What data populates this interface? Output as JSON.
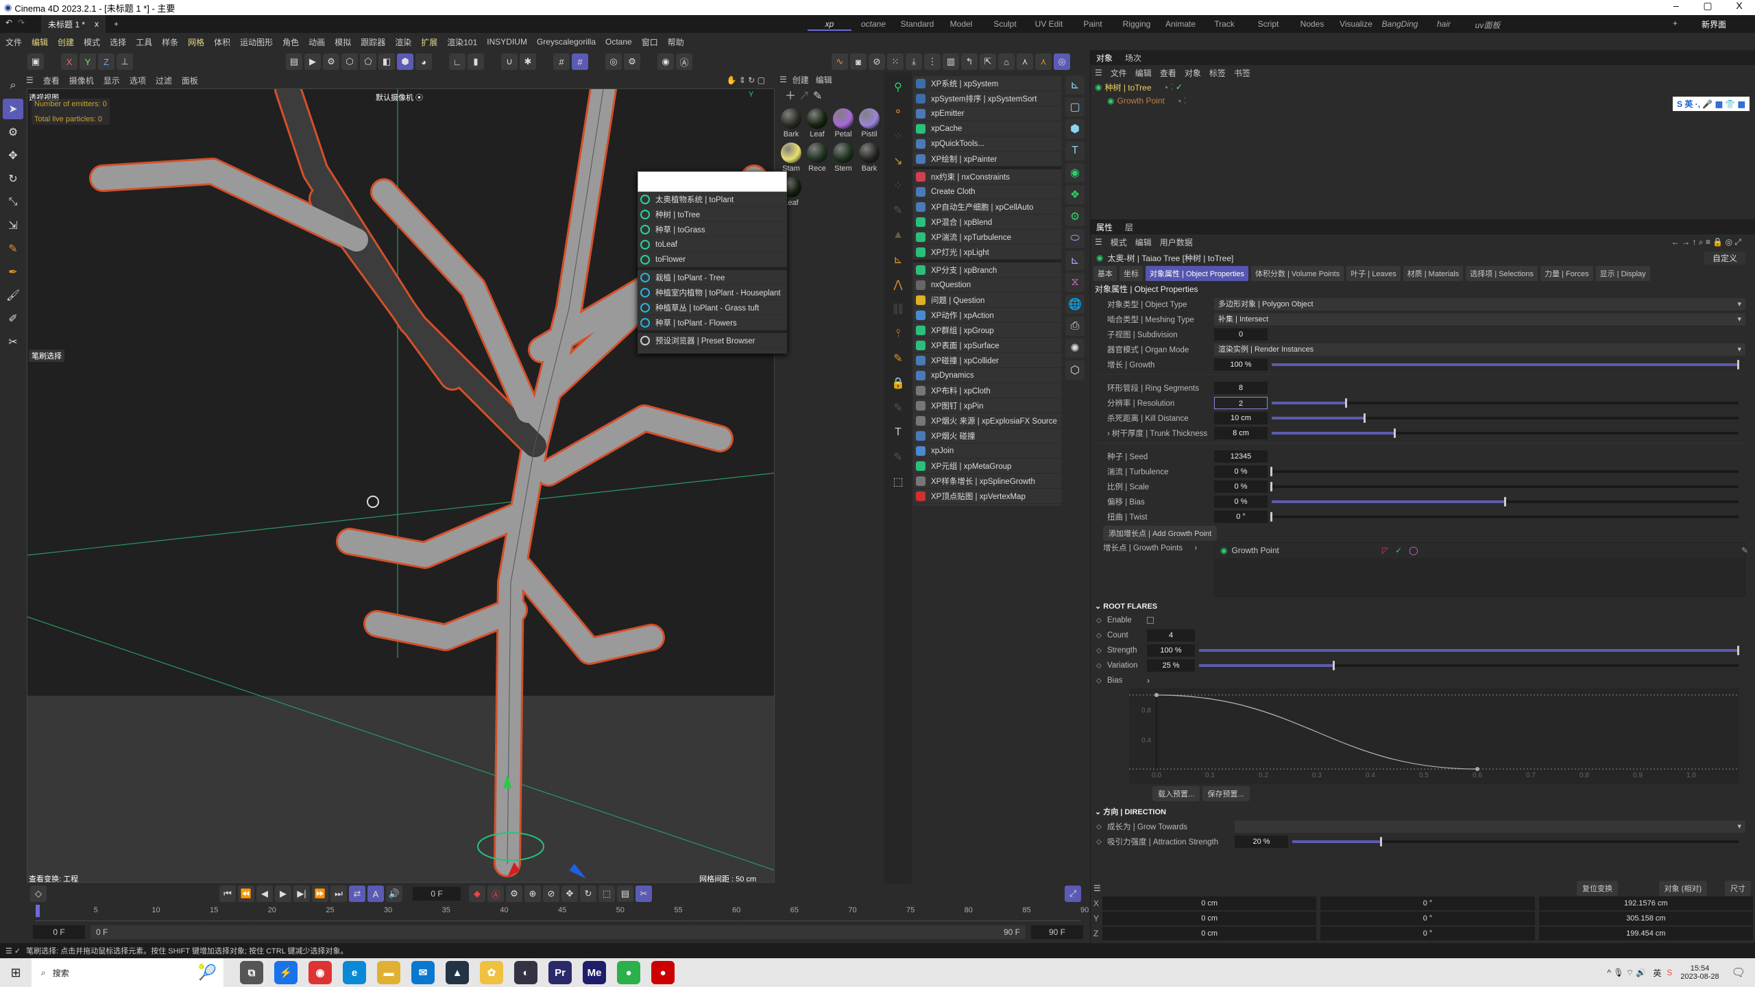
{
  "window": {
    "title": "Cinema 4D 2023.2.1 - [未标题 1 *] - 主要",
    "minimize": "–",
    "maximize": "▢",
    "close": "X"
  },
  "tabs": {
    "doc": "未标题 1 *",
    "close": "x",
    "add": "+"
  },
  "layouts": [
    "xp",
    "octane",
    "Standard",
    "Model",
    "Sculpt",
    "UV Edit",
    "Paint",
    "Rigging",
    "Animate",
    "Track",
    "Script",
    "Nodes",
    "Visualize",
    "BangDing",
    "hair",
    "uv面板"
  ],
  "layout_active": "xp",
  "layout_add": "+",
  "new_ui": "新界面",
  "menu": [
    "文件",
    "编辑",
    "创建",
    "模式",
    "选择",
    "工具",
    "样条",
    "网格",
    "体积",
    "运动图形",
    "角色",
    "动画",
    "模拟",
    "跟踪器",
    "渲染",
    "扩展",
    "渲染101",
    "INSYDIUM",
    "Greyscalegorilla",
    "Octane",
    "窗口",
    "帮助"
  ],
  "toolbar": {
    "x": "X",
    "y": "Y",
    "z": "Z"
  },
  "viewport": {
    "menu": [
      "查看",
      "摄像机",
      "显示",
      "选项",
      "过滤",
      "面板"
    ],
    "name": "透视视图",
    "camera": "默认摄像机 ⦿",
    "emitters": "Number of emitters: 0",
    "particles": "Total live particles: 0",
    "transform": "查看变换: 工程",
    "grid": "网格间距 : 50 cm",
    "brush": "笔刷选择",
    "axis_y": "Y",
    "axis_x": "X",
    "axis_z": "Z"
  },
  "materials": {
    "menu": [
      "创建",
      "编辑"
    ],
    "items": [
      {
        "name": "Bark",
        "color": "#2a2a22"
      },
      {
        "name": "Leaf",
        "color": "#13240f"
      },
      {
        "name": "Petal",
        "color": "#a86ad6"
      },
      {
        "name": "Pistil",
        "color": "#9c85d8"
      },
      {
        "name": "Stam",
        "color": "#e8e070"
      },
      {
        "name": "Rece",
        "color": "#1f3320"
      },
      {
        "name": "Stem",
        "color": "#1d321c"
      },
      {
        "name": "Bark",
        "color": "#262620"
      },
      {
        "name": "Leaf",
        "color": "#14200f"
      }
    ]
  },
  "xp_menu": [
    {
      "label": "XP系统 | xpSystem",
      "color": "#3a6ea8"
    },
    {
      "label": "xpSystem排序 | xpSystemSort",
      "color": "#3a6ea8"
    },
    {
      "label": "xpEmitter",
      "color": "#4a7ab8"
    },
    {
      "label": "xpCache",
      "color": "#2bbf7a"
    },
    {
      "label": "xpQuickTools...",
      "color": "#4a7ab8"
    },
    {
      "label": "XP绘制 | xpPainter",
      "color": "#4a7ab8"
    },
    {
      "sep": true
    },
    {
      "label": "nx约束 | nxConstraints",
      "color": "#d04050"
    },
    {
      "label": "Create Cloth",
      "color": "#4a7ab8"
    },
    {
      "label": "XP自动生产细胞 | xpCellAuto",
      "color": "#4a7ab8"
    },
    {
      "label": "XP混合 | xpBlend",
      "color": "#2bbf7a"
    },
    {
      "label": "XP湍流 | xpTurbulence",
      "color": "#2bbf7a"
    },
    {
      "label": "XP灯光 | xpLight",
      "color": "#2bbf7a"
    },
    {
      "sep": true
    },
    {
      "label": "XP分支 | xpBranch",
      "color": "#2bbf7a"
    },
    {
      "label": "nxQuestion",
      "color": "#666"
    },
    {
      "label": "问题 | Question",
      "color": "#e0b020"
    },
    {
      "label": "XP动作 | xpAction",
      "color": "#4a8ad0"
    },
    {
      "label": "XP群组 | xpGroup",
      "color": "#2bbf7a"
    },
    {
      "label": "XP表面 | xpSurface",
      "color": "#2bbf7a"
    },
    {
      "label": "XP碰撞 | xpCollider",
      "color": "#4a7ab8"
    },
    {
      "label": "xpDynamics",
      "color": "#4a7ab8"
    },
    {
      "label": "XP布料 | xpCloth",
      "color": "#777"
    },
    {
      "label": "XP图钉 | xpPin",
      "color": "#777"
    },
    {
      "label": "XP烟火 来源 | xpExplosiaFX Source",
      "color": "#777"
    },
    {
      "label": "XP烟火 碰撞",
      "color": "#4a7ab8"
    },
    {
      "label": "xpJoin",
      "color": "#4a8ad0"
    },
    {
      "label": "XP元组 | xpMetaGroup",
      "color": "#2bbf7a"
    },
    {
      "label": "XP样条增长 | xpSplineGrowth",
      "color": "#777"
    },
    {
      "label": "XP顶点贴图 | xpVertexMap",
      "color": "#d03030"
    }
  ],
  "plant_popup": {
    "search_value": "",
    "items": [
      {
        "label": "太奥植物系统 | toPlant",
        "kind": "g"
      },
      {
        "label": "种树 | toTree",
        "kind": "g"
      },
      {
        "label": "种草 | toGrass",
        "kind": "g"
      },
      {
        "label": "toLeaf",
        "kind": "g"
      },
      {
        "label": "toFlower",
        "kind": "g"
      },
      {
        "sep": true
      },
      {
        "label": "栽植 | toPlant - Tree",
        "kind": "b"
      },
      {
        "label": "种植室内植物 | toPlant - Houseplant",
        "kind": "b"
      },
      {
        "label": "种植草丛 | toPlant - Grass tuft",
        "kind": "b"
      },
      {
        "label": "种草 | toPlant - Flowers",
        "kind": "b"
      },
      {
        "sep": true
      },
      {
        "label": "预设浏览器 | Preset Browser",
        "kind": "w"
      }
    ]
  },
  "object_manager": {
    "tabs": [
      "对象",
      "场次"
    ],
    "menu": [
      "文件",
      "编辑",
      "查看",
      "对象",
      "标签",
      "书签"
    ],
    "objects": [
      {
        "name": "种树 | toTree"
      },
      {
        "name": "Growth Point"
      }
    ],
    "ime": "S 英 ·, 🎤 ▦ 👕 ▦"
  },
  "attributes": {
    "tabs": [
      "属性",
      "层"
    ],
    "menu": [
      "模式",
      "编辑",
      "用户数据"
    ],
    "object": "太奥-树 | Taiao Tree [种树 | toTree]",
    "preset": "自定义",
    "prop_tabs": [
      "基本",
      "坐标",
      "对象属性 | Object Properties",
      "体积分数 | Volume Points",
      "叶子 | Leaves",
      "材质 | Materials",
      "选择项 | Selections",
      "力量 | Forces",
      "显示 | Display"
    ],
    "active_tab": "对象属性 | Object Properties",
    "section": "对象属性 | Object Properties",
    "rows": [
      {
        "label": "对象类型 | Object Type",
        "drop": "多边形对象 | Polygon Object"
      },
      {
        "label": "啮合类型 | Meshing Type",
        "drop": "补集 | Intersect"
      },
      {
        "label": "子视图 | Subdivision",
        "value": "0"
      },
      {
        "label": "器官模式 | Organ Mode",
        "drop": "渲染实例 | Render Instances"
      },
      {
        "label": "增长 | Growth",
        "value": "100 %",
        "slider": 1.0
      },
      {
        "gap": true
      },
      {
        "label": "环形管段 | Ring Segments",
        "value": "8"
      },
      {
        "label": "分辨率 | Resolution",
        "value": "2",
        "slider": 0.16,
        "edit": true
      },
      {
        "label": "杀死距离 | Kill Distance",
        "value": "10 cm",
        "slider": 0.2
      },
      {
        "label": "› 树干厚度 | Trunk Thickness",
        "value": "8 cm",
        "slider": 0.265
      },
      {
        "gap": true
      },
      {
        "label": "种子 | Seed",
        "value": "12345"
      },
      {
        "label": "湍流 | Turbulence",
        "value": "0 %",
        "slider": 0
      },
      {
        "label": "比例 | Scale",
        "value": "0 %",
        "slider": 0
      },
      {
        "label": "偏移 | Bias",
        "value": "0 %",
        "slider": 0.5
      },
      {
        "label": "扭曲 | Twist",
        "value": "0 °",
        "slider": 0
      }
    ],
    "add_growth": "添加增长点 | Add Growth Point",
    "growth_points_label": "增长点 | Growth Points",
    "growth_point": "Growth Point",
    "root_flares": {
      "title": "ROOT FLARES",
      "enable": "Enable",
      "enabled": false,
      "count_label": "Count",
      "count": "4",
      "strength_label": "Strength",
      "strength": "100 %",
      "strength_frac": 1.0,
      "variation_label": "Variation",
      "variation": "25 %",
      "variation_frac": 0.25,
      "bias_label": "Bias",
      "load": "载入预置...",
      "save": "保存预置..."
    },
    "direction": {
      "title": "方向 | DIRECTION",
      "grow_label": "成长为 | Grow Towards",
      "grow_value": "",
      "attr_label": "吸引力强度 | Attraction Strength",
      "attr_value": "20 %",
      "attr_frac": 0.2
    }
  },
  "chart_data": {
    "type": "line",
    "x_ticks": [
      "0.0",
      "0.1",
      "0.2",
      "0.3",
      "0.4",
      "0.5",
      "0.6",
      "0.7",
      "0.8",
      "0.9",
      "1.0"
    ],
    "y_ticks": [
      "0.8",
      "0.4"
    ],
    "xlim": [
      0,
      1
    ],
    "ylim": [
      0,
      1
    ],
    "points": [
      [
        0,
        1
      ],
      [
        0.6,
        0
      ]
    ]
  },
  "coords": {
    "reset": "复位变换",
    "mode": "对象 (相对)",
    "size": "尺寸",
    "rows": [
      {
        "axis": "X",
        "pos": "0 cm",
        "rot": "0 °",
        "size": "192.1576 cm"
      },
      {
        "axis": "Y",
        "pos": "0 cm",
        "rot": "0 °",
        "size": "305.158 cm"
      },
      {
        "axis": "Z",
        "pos": "0 cm",
        "rot": "0 °",
        "size": "199.454 cm"
      }
    ]
  },
  "timeline": {
    "frame": "0 F",
    "ticks": [
      "0",
      "5",
      "10",
      "15",
      "20",
      "25",
      "30",
      "35",
      "40",
      "45",
      "50",
      "55",
      "60",
      "65",
      "70",
      "75",
      "80",
      "85",
      "90"
    ],
    "start": "0 F",
    "range_start": "0 F",
    "range_end": "90 F",
    "end": "90 F"
  },
  "status": "笔刷选择: 点击并拖动鼠标选择元素。按住 SHIFT 键增加选择对象; 按住 CTRL 键减少选择对象。",
  "taskbar": {
    "search": "搜索",
    "apps": [
      {
        "n": "task-view",
        "g": "⧉",
        "c": "#555"
      },
      {
        "n": "app-blue",
        "g": "⚡",
        "c": "#1a73e8"
      },
      {
        "n": "chrome",
        "g": "◉",
        "c": "#d33"
      },
      {
        "n": "edge",
        "g": "e",
        "c": "#0a8ad6"
      },
      {
        "n": "files",
        "g": "▬",
        "c": "#e0b030"
      },
      {
        "n": "mail",
        "g": "✉",
        "c": "#0a78d0"
      },
      {
        "n": "app-dark",
        "g": "▲",
        "c": "#234"
      },
      {
        "n": "app-yellow",
        "g": "✿",
        "c": "#f0c040"
      },
      {
        "n": "cinema4d",
        "g": "◐",
        "c": "#334"
      },
      {
        "n": "premiere",
        "g": "Pr",
        "c": "#2a2a6a"
      },
      {
        "n": "media-encoder",
        "g": "Me",
        "c": "#1e1e6a"
      },
      {
        "n": "wechat",
        "g": "●",
        "c": "#2bb04a"
      },
      {
        "n": "recorder",
        "g": "●",
        "c": "#c00"
      }
    ],
    "time": "15:54",
    "date": "2023-08-28",
    "ime": "英"
  }
}
